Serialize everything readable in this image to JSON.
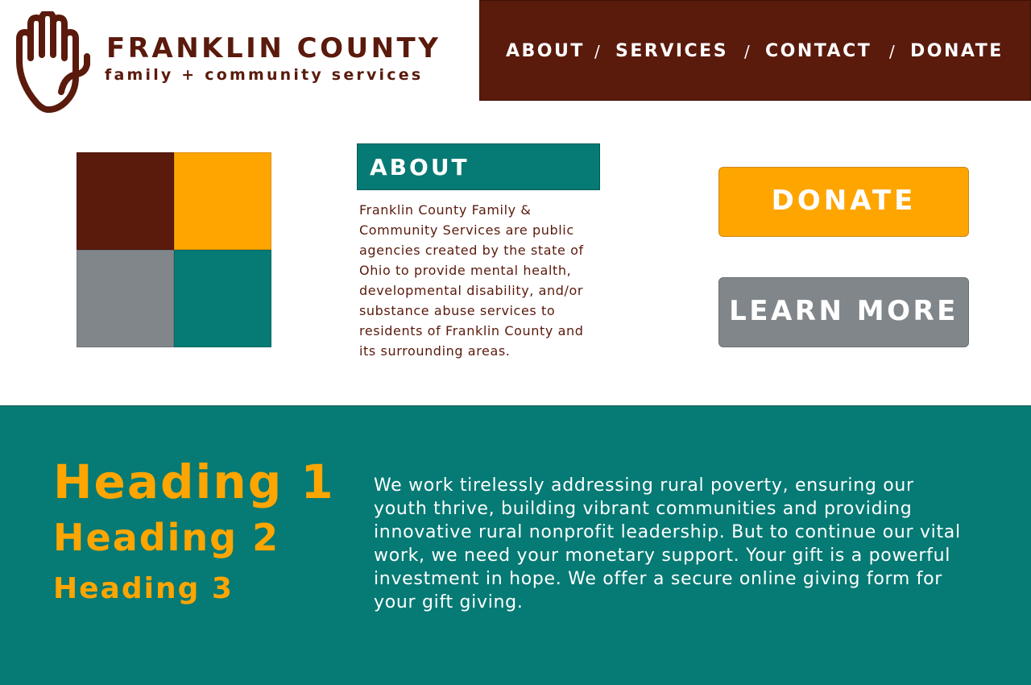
{
  "brand": {
    "name": "FRANKLIN COUNTY",
    "tagline": "family + community services",
    "logo_icon": "hand-icon"
  },
  "nav": {
    "items": [
      {
        "label": "ABOUT"
      },
      {
        "label": "SERVICES"
      },
      {
        "label": "CONTACT"
      },
      {
        "label": "DONATE"
      }
    ],
    "separator": "/"
  },
  "about": {
    "heading": "ABOUT",
    "text": "Franklin County Family & Community Services are public agencies created by the state of Ohio to provide mental health, developmental disability, and/or substance abuse services to residents of Franklin County and its surrounding areas."
  },
  "actions": {
    "donate_label": "DONATE",
    "learn_more_label": "LEARN MORE"
  },
  "band": {
    "heading1": "Heading 1",
    "heading2": "Heading 2",
    "heading3": "Heading 3",
    "text": "We work tirelessly addressing rural poverty, ensuring our youth thrive, building vibrant communities and providing innovative rural nonprofit leadership. But to continue our vital work, we need your monetary support. Your gift is a powerful investment in hope. We offer a secure online giving form for your gift giving."
  },
  "colors": {
    "brown": "#5a1a0c",
    "orange": "#ffa500",
    "gray": "#80868a",
    "teal": "#067a74",
    "white": "#ffffff"
  }
}
